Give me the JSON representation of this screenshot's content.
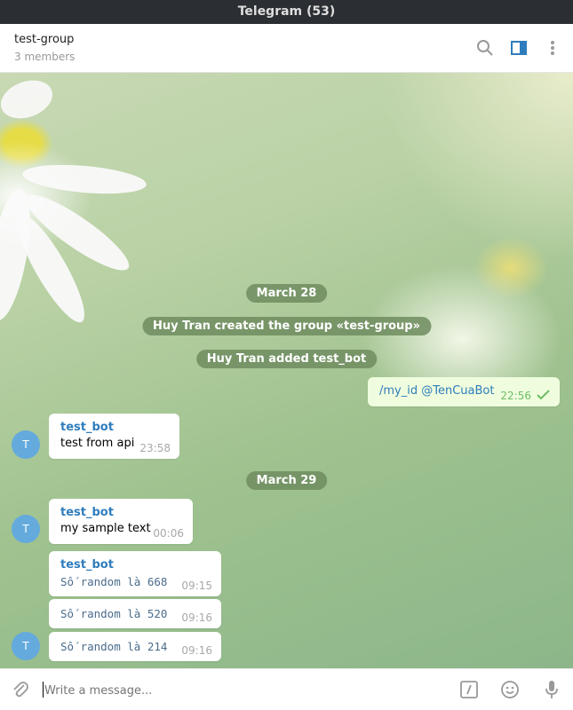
{
  "window": {
    "title": "Telegram (53)"
  },
  "header": {
    "chat_name": "test-group",
    "members": "3 members"
  },
  "services": [
    {
      "text": "March 28"
    },
    {
      "text": "Huy Tran created the group «test-group»"
    },
    {
      "text": "Huy Tran added test_bot"
    },
    {
      "text": "March 29"
    }
  ],
  "messages": [
    {
      "text": "/my_id @TenCuaBot",
      "time": "22:56"
    },
    {
      "sender": "test_bot",
      "text": "test from api",
      "time": "23:58",
      "avatar": "T"
    },
    {
      "sender": "test_bot",
      "text": "my sample text",
      "time": "00:06",
      "avatar": "T"
    },
    {
      "sender": "test_bot",
      "text": "Số random là 668",
      "time": "09:15"
    },
    {
      "text": "Số random là 520",
      "time": "09:16"
    },
    {
      "text": "Số random là 214",
      "time": "09:16",
      "avatar": "T"
    }
  ],
  "input": {
    "placeholder": "Write a message..."
  },
  "icons": [
    "search-icon",
    "sidebar-toggle-icon",
    "more-vertical-icon",
    "attach-icon",
    "bot-command-icon",
    "emoji-icon",
    "microphone-icon",
    "double-check-icon"
  ],
  "colors": {
    "accent": "#2f7dbd",
    "avatar": "#65aadd",
    "outgoing_bubble": "#effdde",
    "service_bg": "#6e8c5f"
  }
}
